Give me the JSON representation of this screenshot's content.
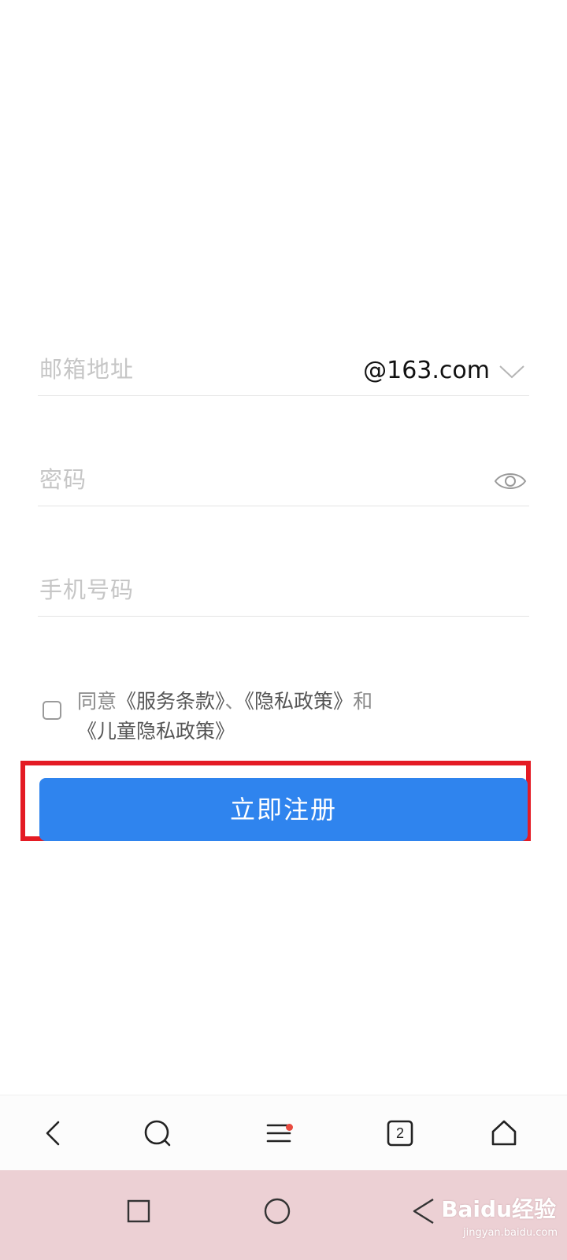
{
  "form": {
    "email": {
      "placeholder": "邮箱地址",
      "domain": "@163.com"
    },
    "password": {
      "placeholder": "密码"
    },
    "phone": {
      "placeholder": "手机号码"
    }
  },
  "agreement": {
    "prefix": "同意",
    "terms": "《服务条款》",
    "sep": "、",
    "privacy": "《隐私政策》",
    "and": "和",
    "child_privacy": "《儿童隐私政策》"
  },
  "register_button": {
    "label": "立即注册"
  },
  "browser_toolbar": {
    "tab_count": "2"
  },
  "watermark": {
    "brand": "Baidu经验",
    "url": "jingyan.baidu.com"
  },
  "colors": {
    "primary": "#2f84ee",
    "highlight": "#e41b24",
    "badge": "#e84a3f"
  },
  "icons": [
    "chevron-down-icon",
    "eye-icon",
    "back-icon",
    "search-icon",
    "menu-icon",
    "tabs-icon",
    "home-icon",
    "recents-icon",
    "home-circle-icon",
    "nav-back-icon"
  ]
}
